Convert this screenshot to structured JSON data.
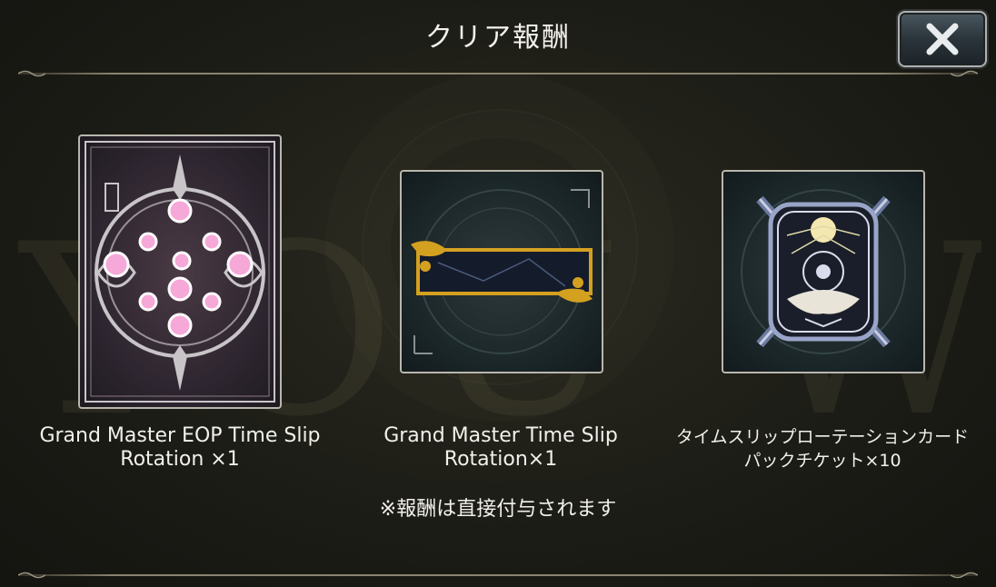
{
  "header": {
    "title": "クリア報酬",
    "close_icon": "close-x-icon"
  },
  "watermark": "YOU WIN",
  "rewards": [
    {
      "name": "Grand Master EOP Time Slip Rotation ×1",
      "icon": "card-sleeve-icon"
    },
    {
      "name": "Grand Master Time Slip Rotation×1",
      "icon": "nameplate-frame-icon"
    },
    {
      "name": "タイムスリップローテーションカードパックチケット×10",
      "icon": "card-pack-ticket-icon"
    }
  ],
  "footer": {
    "note": "※報酬は直接付与されます"
  },
  "colors": {
    "background": "#1a1a14",
    "text": "#f2f0ea",
    "divider": "#8a8470",
    "sleeve_pink": "#f6a8d8",
    "frame_gold": "#d4a020"
  }
}
